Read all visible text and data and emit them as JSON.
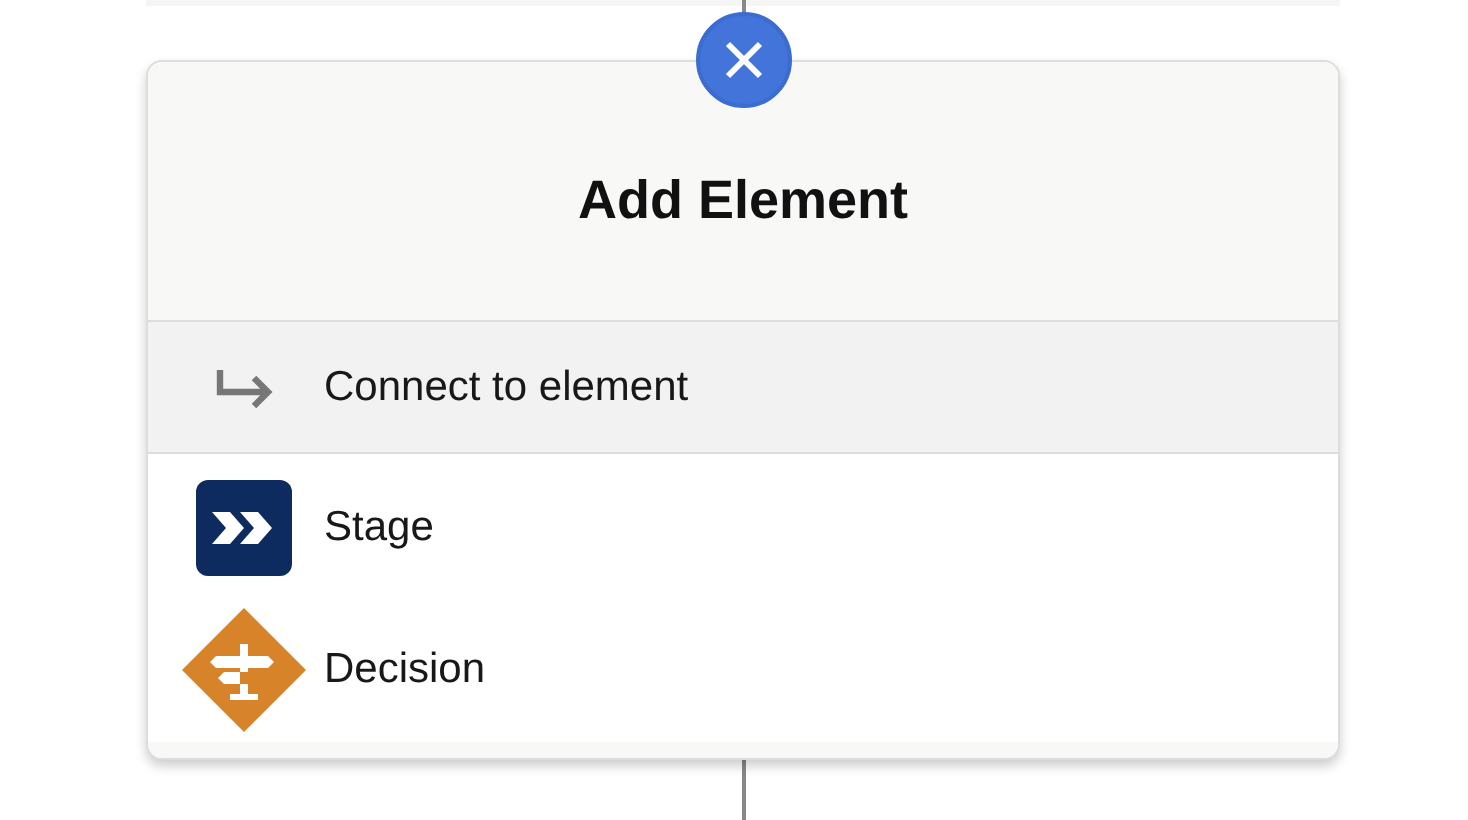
{
  "title": "Add Element",
  "connect": {
    "label": "Connect to element"
  },
  "items": [
    {
      "kind": "stage",
      "label": "Stage"
    },
    {
      "kind": "decision",
      "label": "Decision"
    }
  ]
}
